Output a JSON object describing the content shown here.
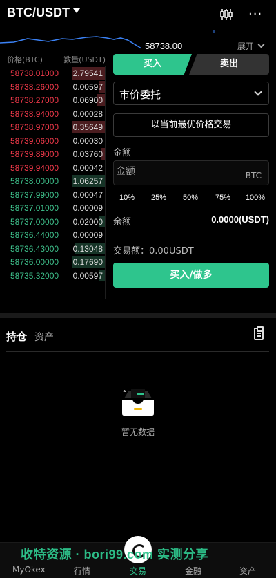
{
  "header": {
    "pair": "BTC/USDT",
    "candle_icon": "candlestick-chart-icon",
    "more_icon": "more-dots-icon",
    "more_label": "···"
  },
  "ticker": {
    "last_price": "58738.00",
    "expand_label": "展开",
    "chart_color": "#3b82f6"
  },
  "orderbook": {
    "price_header": "价格(BTC)",
    "qty_header": "数量(USDT)",
    "asks": [
      {
        "price": "58738.01000",
        "qty": "2.79541",
        "depth": 1.0
      },
      {
        "price": "58738.26000",
        "qty": "0.00597",
        "depth": 0.18
      },
      {
        "price": "58738.27000",
        "qty": "0.06900",
        "depth": 0.22
      },
      {
        "price": "58738.94000",
        "qty": "0.00028",
        "depth": 0.0
      },
      {
        "price": "58738.97000",
        "qty": "0.35649",
        "depth": 1.0
      },
      {
        "price": "58739.06000",
        "qty": "0.00030",
        "depth": 0.0
      },
      {
        "price": "58739.89000",
        "qty": "0.03760",
        "depth": 0.12
      },
      {
        "price": "58739.94000",
        "qty": "0.00042",
        "depth": 0.0
      }
    ],
    "bids": [
      {
        "price": "58738.00000",
        "qty": "1.06257",
        "depth": 1.0
      },
      {
        "price": "58737.99000",
        "qty": "0.00047",
        "depth": 0.0
      },
      {
        "price": "58737.01000",
        "qty": "0.00009",
        "depth": 0.0
      },
      {
        "price": "58737.00000",
        "qty": "0.02000",
        "depth": 0.18
      },
      {
        "price": "58736.44000",
        "qty": "0.00009",
        "depth": 0.0
      },
      {
        "price": "58736.43000",
        "qty": "0.13048",
        "depth": 0.92
      },
      {
        "price": "58736.00000",
        "qty": "0.17690",
        "depth": 1.0
      },
      {
        "price": "58735.32000",
        "qty": "0.00597",
        "depth": 0.18
      }
    ]
  },
  "trade": {
    "buy_tab": "买入",
    "sell_tab": "卖出",
    "order_type": "市价委托",
    "best_price_btn": "以当前最优价格交易",
    "amount_label": "金额",
    "amount_placeholder": "金额",
    "amount_unit": "BTC",
    "percents": [
      "10%",
      "25%",
      "50%",
      "75%",
      "100%"
    ],
    "balance_label": "余额",
    "balance_value": "0.0000(USDT)",
    "trade_amount": "交易额：0.00USDT",
    "submit_label": "买入/做多",
    "buy_color": "#2ec58d",
    "sell_color": "#f0394a"
  },
  "positions": {
    "tab_holdings": "持仓",
    "tab_assets": "资产",
    "clipboard_icon": "clipboard-icon",
    "empty_icon": "empty-inbox-icon",
    "empty_text": "暂无数据"
  },
  "bottom_nav": {
    "items": [
      "MyOkex",
      "行情",
      "交易",
      "金融",
      "资产"
    ],
    "active": "交易"
  },
  "watermark": "收特资源 · bori99.com 实测分享"
}
